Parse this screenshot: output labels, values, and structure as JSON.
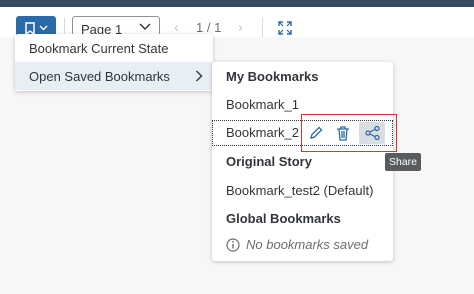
{
  "toolbar": {
    "page_select_value": "Page 1",
    "page_count": "1 / 1"
  },
  "bookmark_menu": {
    "items": [
      {
        "label": "Bookmark Current State"
      },
      {
        "label": "Open Saved Bookmarks"
      }
    ]
  },
  "saved_bookmarks": {
    "my_bookmarks_heading": "My Bookmarks",
    "my_bookmarks": [
      "Bookmark_1",
      "Bookmark_2"
    ],
    "original_story_heading": "Original Story",
    "original_story_item": "Bookmark_test2 (Default)",
    "global_bookmarks_heading": "Global Bookmarks",
    "global_empty_text": "No bookmarks saved"
  },
  "row_actions": {
    "edit_icon": "pencil-icon",
    "delete_icon": "trash-icon",
    "share_icon": "share-icon",
    "tooltip": "Share"
  },
  "colors": {
    "primary": "#2a6aa8",
    "highlight_border": "#d9362b",
    "hover_bg": "#e8eef5"
  }
}
